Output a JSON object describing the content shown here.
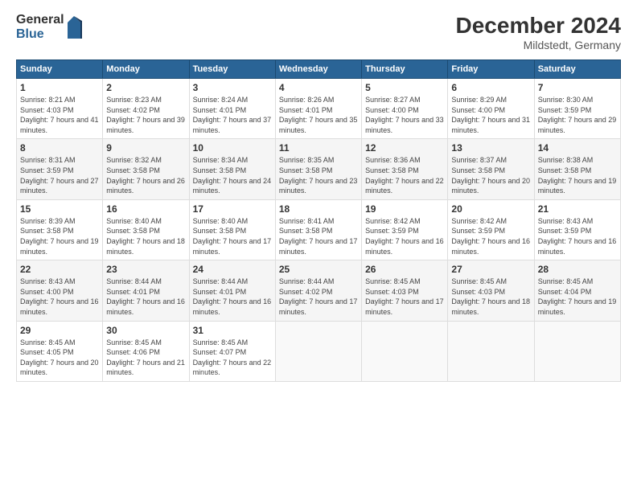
{
  "logo": {
    "general": "General",
    "blue": "Blue"
  },
  "title": "December 2024",
  "subtitle": "Mildstedt, Germany",
  "weekdays": [
    "Sunday",
    "Monday",
    "Tuesday",
    "Wednesday",
    "Thursday",
    "Friday",
    "Saturday"
  ],
  "weeks": [
    [
      {
        "day": "1",
        "sunrise": "8:21 AM",
        "sunset": "4:03 PM",
        "daylight": "7 hours and 41 minutes."
      },
      {
        "day": "2",
        "sunrise": "8:23 AM",
        "sunset": "4:02 PM",
        "daylight": "7 hours and 39 minutes."
      },
      {
        "day": "3",
        "sunrise": "8:24 AM",
        "sunset": "4:01 PM",
        "daylight": "7 hours and 37 minutes."
      },
      {
        "day": "4",
        "sunrise": "8:26 AM",
        "sunset": "4:01 PM",
        "daylight": "7 hours and 35 minutes."
      },
      {
        "day": "5",
        "sunrise": "8:27 AM",
        "sunset": "4:00 PM",
        "daylight": "7 hours and 33 minutes."
      },
      {
        "day": "6",
        "sunrise": "8:29 AM",
        "sunset": "4:00 PM",
        "daylight": "7 hours and 31 minutes."
      },
      {
        "day": "7",
        "sunrise": "8:30 AM",
        "sunset": "3:59 PM",
        "daylight": "7 hours and 29 minutes."
      }
    ],
    [
      {
        "day": "8",
        "sunrise": "8:31 AM",
        "sunset": "3:59 PM",
        "daylight": "7 hours and 27 minutes."
      },
      {
        "day": "9",
        "sunrise": "8:32 AM",
        "sunset": "3:58 PM",
        "daylight": "7 hours and 26 minutes."
      },
      {
        "day": "10",
        "sunrise": "8:34 AM",
        "sunset": "3:58 PM",
        "daylight": "7 hours and 24 minutes."
      },
      {
        "day": "11",
        "sunrise": "8:35 AM",
        "sunset": "3:58 PM",
        "daylight": "7 hours and 23 minutes."
      },
      {
        "day": "12",
        "sunrise": "8:36 AM",
        "sunset": "3:58 PM",
        "daylight": "7 hours and 22 minutes."
      },
      {
        "day": "13",
        "sunrise": "8:37 AM",
        "sunset": "3:58 PM",
        "daylight": "7 hours and 20 minutes."
      },
      {
        "day": "14",
        "sunrise": "8:38 AM",
        "sunset": "3:58 PM",
        "daylight": "7 hours and 19 minutes."
      }
    ],
    [
      {
        "day": "15",
        "sunrise": "8:39 AM",
        "sunset": "3:58 PM",
        "daylight": "7 hours and 19 minutes."
      },
      {
        "day": "16",
        "sunrise": "8:40 AM",
        "sunset": "3:58 PM",
        "daylight": "7 hours and 18 minutes."
      },
      {
        "day": "17",
        "sunrise": "8:40 AM",
        "sunset": "3:58 PM",
        "daylight": "7 hours and 17 minutes."
      },
      {
        "day": "18",
        "sunrise": "8:41 AM",
        "sunset": "3:58 PM",
        "daylight": "7 hours and 17 minutes."
      },
      {
        "day": "19",
        "sunrise": "8:42 AM",
        "sunset": "3:59 PM",
        "daylight": "7 hours and 16 minutes."
      },
      {
        "day": "20",
        "sunrise": "8:42 AM",
        "sunset": "3:59 PM",
        "daylight": "7 hours and 16 minutes."
      },
      {
        "day": "21",
        "sunrise": "8:43 AM",
        "sunset": "3:59 PM",
        "daylight": "7 hours and 16 minutes."
      }
    ],
    [
      {
        "day": "22",
        "sunrise": "8:43 AM",
        "sunset": "4:00 PM",
        "daylight": "7 hours and 16 minutes."
      },
      {
        "day": "23",
        "sunrise": "8:44 AM",
        "sunset": "4:01 PM",
        "daylight": "7 hours and 16 minutes."
      },
      {
        "day": "24",
        "sunrise": "8:44 AM",
        "sunset": "4:01 PM",
        "daylight": "7 hours and 16 minutes."
      },
      {
        "day": "25",
        "sunrise": "8:44 AM",
        "sunset": "4:02 PM",
        "daylight": "7 hours and 17 minutes."
      },
      {
        "day": "26",
        "sunrise": "8:45 AM",
        "sunset": "4:03 PM",
        "daylight": "7 hours and 17 minutes."
      },
      {
        "day": "27",
        "sunrise": "8:45 AM",
        "sunset": "4:03 PM",
        "daylight": "7 hours and 18 minutes."
      },
      {
        "day": "28",
        "sunrise": "8:45 AM",
        "sunset": "4:04 PM",
        "daylight": "7 hours and 19 minutes."
      }
    ],
    [
      {
        "day": "29",
        "sunrise": "8:45 AM",
        "sunset": "4:05 PM",
        "daylight": "7 hours and 20 minutes."
      },
      {
        "day": "30",
        "sunrise": "8:45 AM",
        "sunset": "4:06 PM",
        "daylight": "7 hours and 21 minutes."
      },
      {
        "day": "31",
        "sunrise": "8:45 AM",
        "sunset": "4:07 PM",
        "daylight": "7 hours and 22 minutes."
      },
      null,
      null,
      null,
      null
    ]
  ]
}
